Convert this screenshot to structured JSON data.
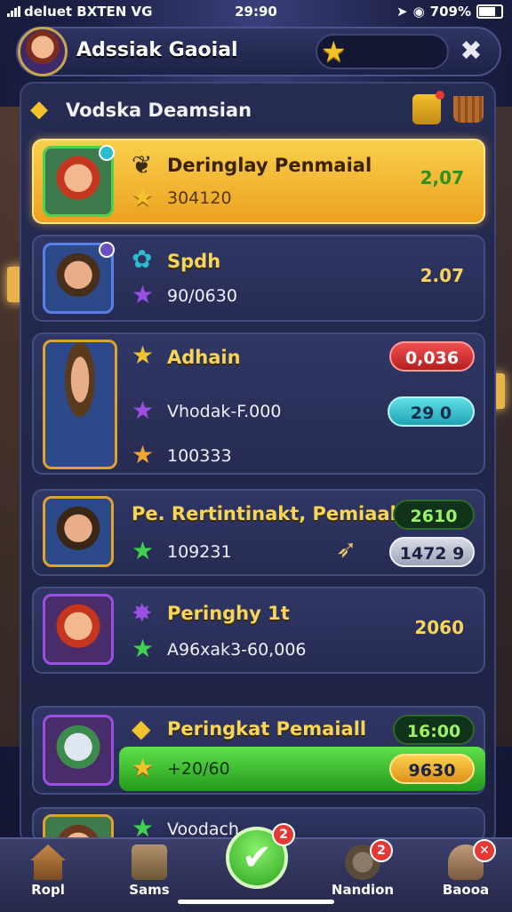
{
  "status_bar": {
    "carrier": "deluet BXTEN VG",
    "time": "29:90",
    "battery": "709%"
  },
  "header": {
    "title": "Adssiak Gaoial"
  },
  "panel": {
    "title": "Vodska Deamsian"
  },
  "rows": [
    {
      "name": "Deringlay Penmaial",
      "sub": "304120",
      "score": "2,07"
    },
    {
      "name": "Spdh",
      "sub": "90/0630",
      "score": "2.07"
    },
    {
      "name": "Adhain",
      "sub1": "Vhodak-F.000",
      "sub2": "100333",
      "pill_red": "0,036",
      "pill_teal": "29 0"
    },
    {
      "name": "Pe. Rertintinakt, Pemiaal",
      "sub": "109231",
      "pill_dark": "2610",
      "pill_grey": "1472 9"
    },
    {
      "name": "Peringhy 1t",
      "sub": "A96xak3-60,006",
      "score": "2060"
    },
    {
      "name": "Peringkat Pemaiall",
      "sub": "+20/60",
      "pill_dark": "16:00",
      "pill_gold": "9630"
    },
    {
      "name": "Voodach"
    }
  ],
  "nav": {
    "items": [
      {
        "label": "Ropl"
      },
      {
        "label": "Sams"
      },
      {
        "label": "",
        "badge": "2"
      },
      {
        "label": "Nandion",
        "badge": "2"
      },
      {
        "label": "Baooa",
        "badge": "✕"
      }
    ]
  },
  "colors": {
    "accent_gold": "#f7d45a",
    "highlight_row": "#f9cf4c",
    "success_green": "#5ee04a"
  }
}
